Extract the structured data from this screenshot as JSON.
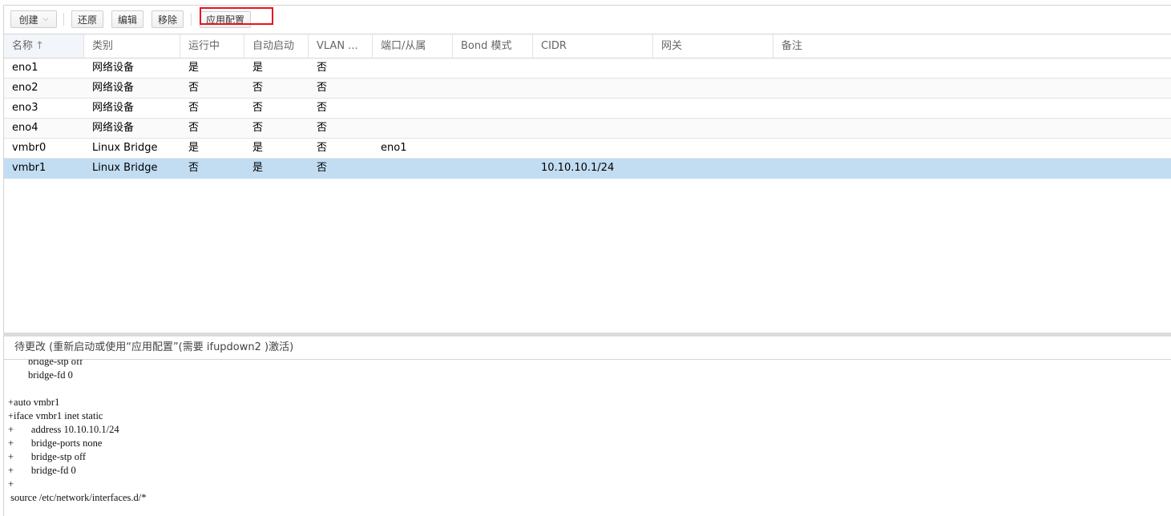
{
  "toolbar": {
    "create_label": "创建",
    "revert_label": "还原",
    "edit_label": "编辑",
    "remove_label": "移除",
    "apply_label": "应用配置"
  },
  "grid": {
    "columns": [
      "名称",
      "类别",
      "运行中",
      "自动启动",
      "VLAN ...",
      "端口/从属",
      "Bond 模式",
      "CIDR",
      "网关",
      "备注"
    ],
    "sort_indicator": "↑",
    "rows": [
      {
        "name": "eno1",
        "type": "网络设备",
        "active": "是",
        "autostart": "是",
        "vlan": "否",
        "ports": "",
        "bond": "",
        "cidr": "",
        "gateway": "",
        "comment": ""
      },
      {
        "name": "eno2",
        "type": "网络设备",
        "active": "否",
        "autostart": "否",
        "vlan": "否",
        "ports": "",
        "bond": "",
        "cidr": "",
        "gateway": "",
        "comment": ""
      },
      {
        "name": "eno3",
        "type": "网络设备",
        "active": "否",
        "autostart": "否",
        "vlan": "否",
        "ports": "",
        "bond": "",
        "cidr": "",
        "gateway": "",
        "comment": ""
      },
      {
        "name": "eno4",
        "type": "网络设备",
        "active": "否",
        "autostart": "否",
        "vlan": "否",
        "ports": "",
        "bond": "",
        "cidr": "",
        "gateway": "",
        "comment": ""
      },
      {
        "name": "vmbr0",
        "type": "Linux Bridge",
        "active": "是",
        "autostart": "是",
        "vlan": "否",
        "ports": "eno1",
        "bond": "",
        "cidr": "",
        "gateway": "",
        "comment": ""
      },
      {
        "name": "vmbr1",
        "type": "Linux Bridge",
        "active": "否",
        "autostart": "是",
        "vlan": "否",
        "ports": "",
        "bond": "",
        "cidr": "10.10.10.1/24",
        "gateway": "",
        "comment": ""
      }
    ]
  },
  "pending": {
    "title": "待更改 (重新启动或使用“应用配置”(需要 ifupdown2 )激活)",
    "diff_lines": [
      "        bridge-stp off",
      "        bridge-fd 0",
      "",
      "+auto vmbr1",
      "+iface vmbr1 inet static",
      "+       address 10.10.10.1/24",
      "+       bridge-ports none",
      "+       bridge-stp off",
      "+       bridge-fd 0",
      "+",
      " source /etc/network/interfaces.d/*"
    ]
  },
  "colors": {
    "selected_row": "#c2ddf2",
    "highlight_box": "#e8141c"
  }
}
